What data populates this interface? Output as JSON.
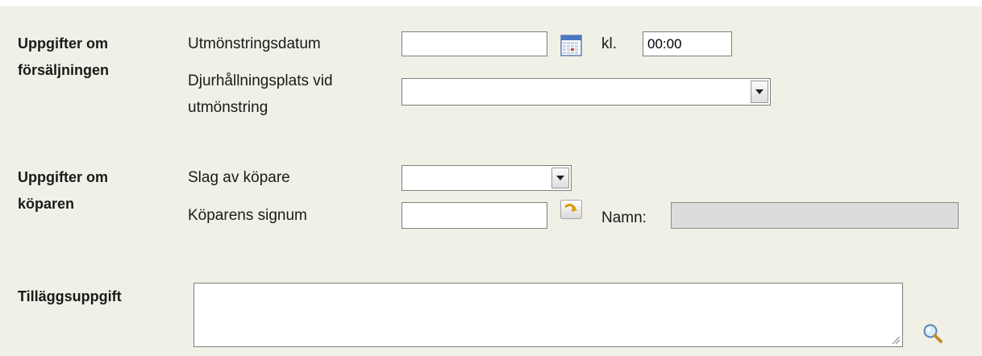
{
  "sale_section": {
    "title": "Uppgifter om försäljningen",
    "title_line1": "Uppgifter om",
    "title_line2": "försäljningen",
    "discharge_date_label": "Utmönstringsdatum",
    "discharge_date_value": "",
    "time_label": "kl.",
    "time_value": "00:00",
    "holding_label_line1": "Djurhållningsplats vid",
    "holding_label_line2": "utmönstring",
    "holding_selected": ""
  },
  "buyer_section": {
    "title_line1": "Uppgifter om",
    "title_line2": "köparen",
    "buyer_type_label": "Slag av köpare",
    "buyer_type_selected": "",
    "buyer_id_label": "Köparens signum",
    "buyer_id_value": "",
    "name_label": "Namn:",
    "name_value": ""
  },
  "extra_section": {
    "label": "Tilläggsuppgift",
    "value": ""
  },
  "icons": {
    "calendar": "calendar-icon",
    "fetch": "arrow-fetch-icon",
    "search": "magnifier-icon"
  },
  "colors": {
    "panel_background": "#f0f0e6",
    "disabled_field": "#dcdcdc"
  }
}
